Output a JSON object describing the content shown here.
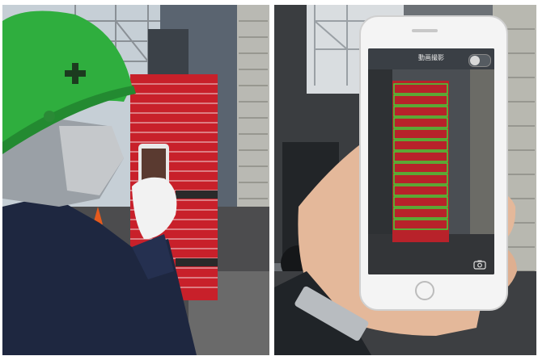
{
  "scene": {
    "description_panels": [
      "left-photo",
      "right-photo"
    ]
  },
  "phone_app": {
    "title": "動画撮影",
    "toggle_state": "off",
    "detected_box_count": 13,
    "detection_color": "#35e03a",
    "icons": [
      "toggle-switch",
      "camera-switch-icon"
    ]
  },
  "colors": {
    "helmet": "#2fae3e",
    "pizza_box": "#c8202a",
    "jacket": "#1e2740",
    "glove": "#f2f2f2"
  }
}
